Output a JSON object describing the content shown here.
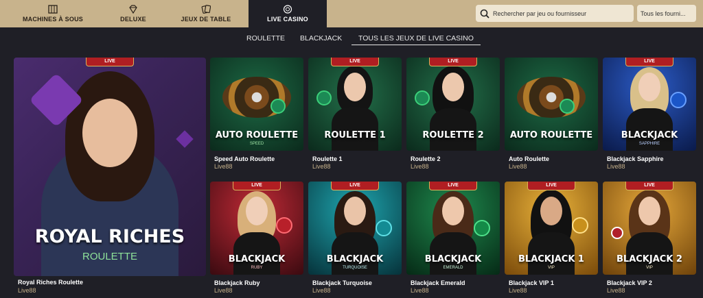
{
  "nav": {
    "items": [
      {
        "label": "MACHINES À SOUS",
        "icon": "slot-machine-icon"
      },
      {
        "label": "DELUXE",
        "icon": "diamond-icon"
      },
      {
        "label": "JEUX DE TABLE",
        "icon": "cards-icon"
      },
      {
        "label": "LIVE CASINO",
        "icon": "chip-icon",
        "active": true
      }
    ],
    "search_placeholder": "Rechercher par jeu ou fournisseur",
    "provider_select": "Tous les fourni..."
  },
  "subtabs": {
    "roulette": "ROULETTE",
    "blackjack": "BLACKJACK",
    "all": "TOUS LES JEUX DE LIVE CASINO"
  },
  "live_label": "LIVE",
  "featured": {
    "title": "ROYAL RICHES",
    "subtitle": "ROULETTE",
    "name": "Royal Riches Roulette",
    "provider": "Live88"
  },
  "games": [
    {
      "title": "AUTO ROULETTE",
      "sub": "SPEED",
      "name": "Speed Auto Roulette",
      "provider": "Live88"
    },
    {
      "title": "ROULETTE 1",
      "sub": "",
      "name": "Roulette 1",
      "provider": "Live88"
    },
    {
      "title": "ROULETTE 2",
      "sub": "",
      "name": "Roulette 2",
      "provider": "Live88"
    },
    {
      "title": "AUTO ROULETTE",
      "sub": "",
      "name": "Auto Roulette",
      "provider": "Live88"
    },
    {
      "title": "BLACKJACK",
      "sub": "SAPPHIRE",
      "name": "Blackjack Sapphire",
      "provider": "Live88"
    },
    {
      "title": "BLACKJACK",
      "sub": "RUBY",
      "name": "Blackjack Ruby",
      "provider": "Live88"
    },
    {
      "title": "BLACKJACK",
      "sub": "TURQUOISE",
      "name": "Blackjack Turquoise",
      "provider": "Live88"
    },
    {
      "title": "BLACKJACK",
      "sub": "EMERALD",
      "name": "Blackjack Emerald",
      "provider": "Live88"
    },
    {
      "title": "BLACKJACK 1",
      "sub": "VIP",
      "name": "Blackjack VIP 1",
      "provider": "Live88"
    },
    {
      "title": "BLACKJACK 2",
      "sub": "VIP",
      "name": "Blackjack VIP 2",
      "provider": "Live88"
    }
  ],
  "colors": {
    "topbar": "#c8b38c",
    "background": "#1f1f26",
    "live_badge": "#b01e22",
    "provider_text": "#c8b38c"
  }
}
